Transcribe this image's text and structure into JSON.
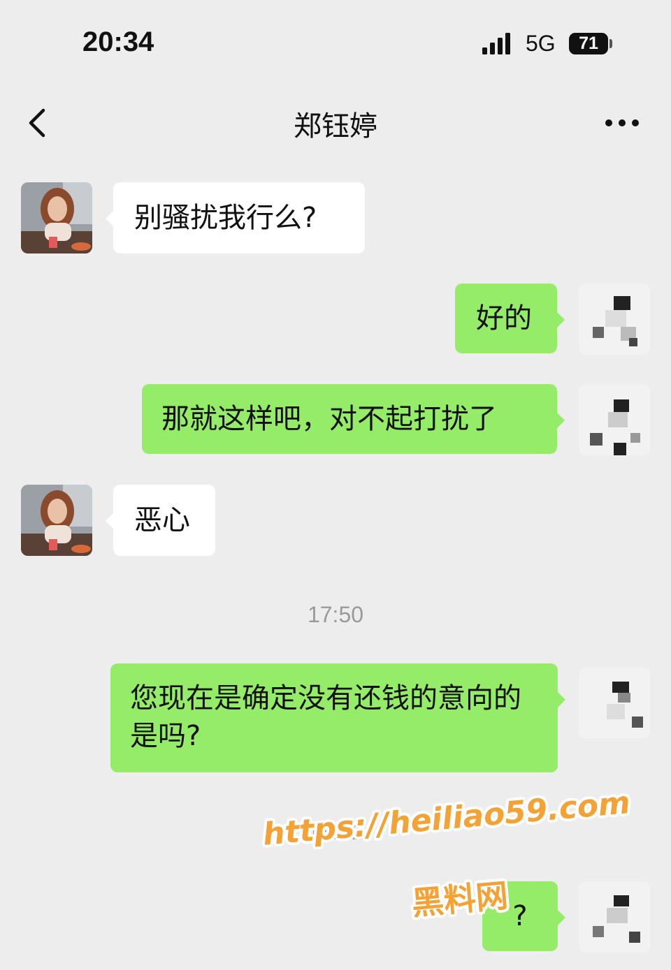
{
  "status_bar": {
    "time": "20:34",
    "network": "5G",
    "battery": "71"
  },
  "header": {
    "contact_name": "郑钰婷",
    "back_icon": "chevron-left-icon",
    "more_icon": "more-dots-icon"
  },
  "messages": [
    {
      "from": "contact",
      "text": "别骚扰我行么?"
    },
    {
      "from": "me",
      "text": "好的"
    },
    {
      "from": "me",
      "text": "那就这样吧，对不起打扰了"
    },
    {
      "from": "contact",
      "text": "恶心"
    },
    {
      "from": "me",
      "text": "您现在是确定没有还钱的意向的是吗?"
    },
    {
      "from": "me",
      "text": "?"
    }
  ],
  "timestamps": [
    "17:50",
    "18:01"
  ],
  "watermark": {
    "url": "https://heiliao59.com",
    "name": "黑料网"
  },
  "colors": {
    "background": "#ededed",
    "outgoing_bubble": "#95ec69",
    "incoming_bubble": "#ffffff",
    "watermark": "#f4a236"
  }
}
